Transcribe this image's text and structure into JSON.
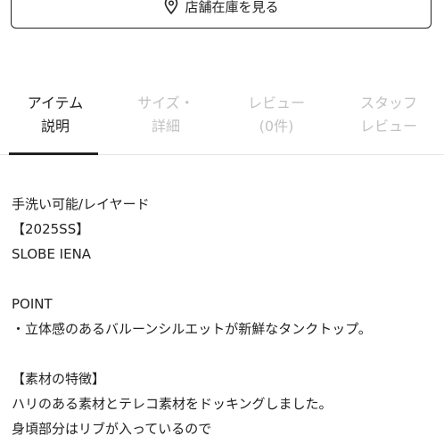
{
  "store_button": {
    "label": "店舗在庫を見る",
    "icon": "map-pin-icon"
  },
  "tabs": [
    {
      "line1": "アイテム",
      "line2": "説明",
      "active": true
    },
    {
      "line1": "サイズ・",
      "line2": "詳細",
      "active": false
    },
    {
      "line1": "レビュー",
      "line2": "(0件)",
      "active": false
    },
    {
      "line1": "スタッフ",
      "line2": "レビュー",
      "active": false
    }
  ],
  "description": {
    "line1": "手洗い可能/レイヤード",
    "line2": "【2025SS】",
    "line3": "SLOBE IENA",
    "point_heading": "POINT",
    "point_text": "・立体感のあるバルーンシルエットが新鮮なタンクトップ。",
    "material_heading": "【素材の特徴】",
    "material_text1": "ハリのある素材とテレコ素材をドッキングしました。",
    "material_text2": "身頃部分はリブが入っているので"
  },
  "colors": {
    "text": "#222222",
    "inactive_tab": "#c2c2c2",
    "divider": "#e6e6e6"
  }
}
